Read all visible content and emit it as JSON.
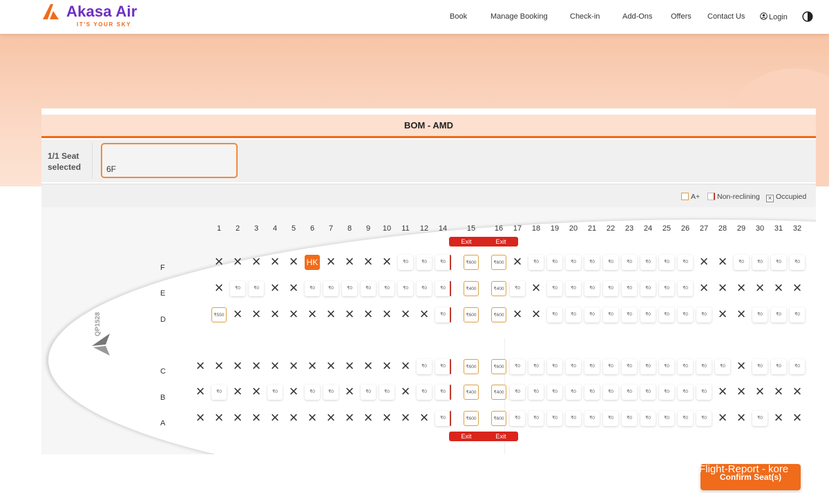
{
  "header": {
    "brand": "Akasa Air",
    "tagline": "IT'S YOUR SKY",
    "nav": [
      "Book",
      "Manage Booking",
      "Check-in",
      "Add-Ons",
      "Offers",
      "Contact Us"
    ],
    "login": "Login",
    "icons": {
      "logo": "akasa-logo-icon",
      "user": "user-icon",
      "theme": "contrast-icon"
    }
  },
  "route": "BOM - AMD",
  "selection": {
    "label": "1/1 Seat selected",
    "seat": "6F"
  },
  "legend": {
    "a_plus": "A+",
    "non_reclining": "Non-reclining",
    "occupied": "Occupied"
  },
  "flight_number": "QP1528",
  "columns": [
    "1",
    "2",
    "3",
    "4",
    "5",
    "6",
    "7",
    "8",
    "9",
    "10",
    "11",
    "12",
    "13",
    "14",
    "15",
    "16",
    "17",
    "18",
    "19",
    "20",
    "21",
    "22",
    "23",
    "24",
    "25",
    "26",
    "27",
    "28",
    "29",
    "30",
    "31",
    "32"
  ],
  "rows": [
    {
      "label": "F",
      "seats": [
        "X",
        "X",
        "X",
        "X",
        "X",
        "HK",
        "X",
        "X",
        "X",
        "X",
        "₹0",
        "₹0",
        "₹0",
        "₹600",
        "₹600",
        "X",
        "₹0",
        "₹0",
        "₹0",
        "₹0",
        "₹0",
        "₹0",
        "₹0",
        "₹0",
        "₹0",
        "X",
        "X",
        "₹0",
        "₹0",
        "₹0",
        "₹0"
      ]
    },
    {
      "label": "E",
      "seats": [
        "X",
        "₹0",
        "₹0",
        "X",
        "X",
        "₹0",
        "₹0",
        "₹0",
        "₹0",
        "₹0",
        "₹0",
        "₹0",
        "₹0",
        "₹400",
        "₹400",
        "₹0",
        "X",
        "₹0",
        "₹0",
        "₹0",
        "₹0",
        "₹0",
        "₹0",
        "₹0",
        "₹0",
        "X",
        "X",
        "X",
        "X",
        "X",
        "X"
      ]
    },
    {
      "label": "D",
      "seats": [
        "₹550",
        "X",
        "X",
        "X",
        "X",
        "X",
        "X",
        "X",
        "X",
        "X",
        "X",
        "X",
        "₹0",
        "₹600",
        "₹600",
        "X",
        "X",
        "₹0",
        "₹0",
        "₹0",
        "₹0",
        "₹0",
        "₹0",
        "₹0",
        "₹0",
        "₹0",
        "X",
        "X",
        "₹0",
        "₹0",
        "₹0"
      ]
    },
    {
      "label": "C",
      "seats": [
        "X",
        "X",
        "X",
        "X",
        "X",
        "X",
        "X",
        "X",
        "X",
        "X",
        "X",
        "X",
        "₹0",
        "₹0",
        "₹600",
        "₹600",
        "₹0",
        "₹0",
        "₹0",
        "₹0",
        "₹0",
        "₹0",
        "₹0",
        "₹0",
        "₹0",
        "₹0",
        "₹0",
        "₹0",
        "X",
        "₹0",
        "₹0",
        "₹0"
      ]
    },
    {
      "label": "B",
      "seats": [
        "X",
        "₹0",
        "X",
        "X",
        "₹0",
        "X",
        "₹0",
        "₹0",
        "X",
        "₹0",
        "₹0",
        "X",
        "₹0",
        "₹0",
        "₹400",
        "₹400",
        "₹0",
        "₹0",
        "₹0",
        "₹0",
        "₹0",
        "₹0",
        "₹0",
        "₹0",
        "₹0",
        "₹0",
        "₹0",
        "X",
        "X",
        "X",
        "X",
        "X"
      ]
    },
    {
      "label": "A",
      "seats": [
        "X",
        "X",
        "X",
        "X",
        "X",
        "X",
        "X",
        "X",
        "X",
        "X",
        "X",
        "X",
        "X",
        "₹0",
        "₹600",
        "₹600",
        "₹0",
        "₹0",
        "₹0",
        "₹0",
        "₹0",
        "₹0",
        "₹0",
        "₹0",
        "₹0",
        "₹0",
        "₹0",
        "X",
        "X",
        "₹0",
        "X",
        "X"
      ]
    }
  ],
  "exit_label": "Exit",
  "confirm_button": "Confirm Seat(s)",
  "overlay_text": "Flight-Report - kore"
}
